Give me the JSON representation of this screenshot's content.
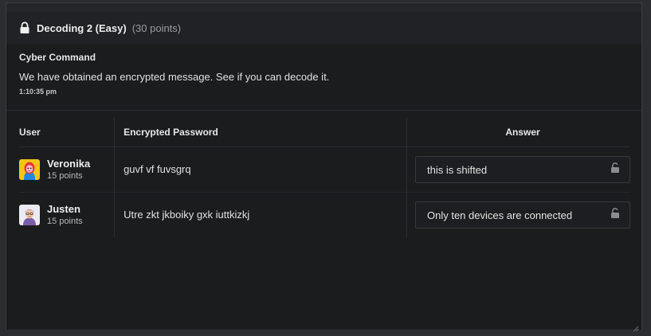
{
  "header": {
    "title": "Decoding 2 (Easy)",
    "points": "(30 points)",
    "icon": "lock-icon"
  },
  "message": {
    "sender": "Cyber Command",
    "text": "We have obtained an encrypted message. See if you can decode it.",
    "time": "1:10:35 pm"
  },
  "table": {
    "headers": {
      "user": "User",
      "encrypted": "Encrypted Password",
      "answer": "Answer"
    },
    "rows": [
      {
        "name": "Veronika",
        "points": "15 points",
        "avatar_bg": "#f5c518",
        "encrypted": "guvf vf fuvsgrq",
        "answer": "this is shifted"
      },
      {
        "name": "Justen",
        "points": "15 points",
        "avatar_bg": "#e8e8ef",
        "encrypted": "Utre zkt jkboiky gxk iuttkizkj",
        "answer": "Only ten devices are connected"
      }
    ]
  },
  "colors": {
    "background": "#1b1c1e",
    "header": "#202225",
    "text": "#e0e0e0",
    "muted": "#9a9ca0"
  }
}
